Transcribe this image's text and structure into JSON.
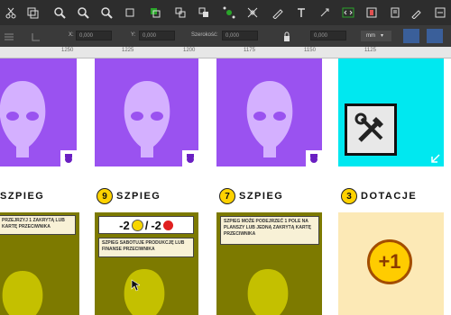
{
  "toolbar": {
    "tools": [
      "scissors-icon",
      "duplicate-icon",
      "zoom-in-icon",
      "zoom-out-icon",
      "zoom-fit-icon",
      "crop-icon",
      "group-icon",
      "ungroup-icon",
      "align-icon",
      "node-icon",
      "transform-icon",
      "pen-icon",
      "text-icon",
      "shape-icon",
      "code-icon",
      "layers-icon",
      "book-icon",
      "edit-icon",
      "arrow-icon",
      "settings-icon"
    ],
    "accent": "#2d2d2d"
  },
  "propbar": {
    "x_label": "X:",
    "x_value": "0,000",
    "y_label": "Y:",
    "y_value": "0,000",
    "w_label": "Szerokość:",
    "w_value": "0,000",
    "h_value": "0,000",
    "unit": "mm"
  },
  "ruler": {
    "ticks": [
      "1250",
      "1225",
      "1200",
      "1175",
      "1150",
      "1125"
    ]
  },
  "cards": {
    "titles": [
      "SZPIEG",
      "SZPIEG",
      "SZPIEG",
      "DOTACJE"
    ],
    "numbers": [
      "9",
      "7",
      "3"
    ],
    "note_1": "PRZEJRZYJ 1 ZAKRYTĄ LUB KARTĘ PRZECIWNIKA",
    "cost": "-2",
    "cost_separator": "/",
    "cost2": "-2",
    "note_2": "SZPIEG SABOTUJE PRODUKCJĘ LUB FINANSE PRZECIWNIKA",
    "note_3": "SZPIEG MOŻE PODEJRZEĆ 1 POLE NA PLANSZY LUB JEDNĄ ZAKRYTĄ KARTĘ PRZECIWNIKA",
    "coin_label": "+1"
  }
}
